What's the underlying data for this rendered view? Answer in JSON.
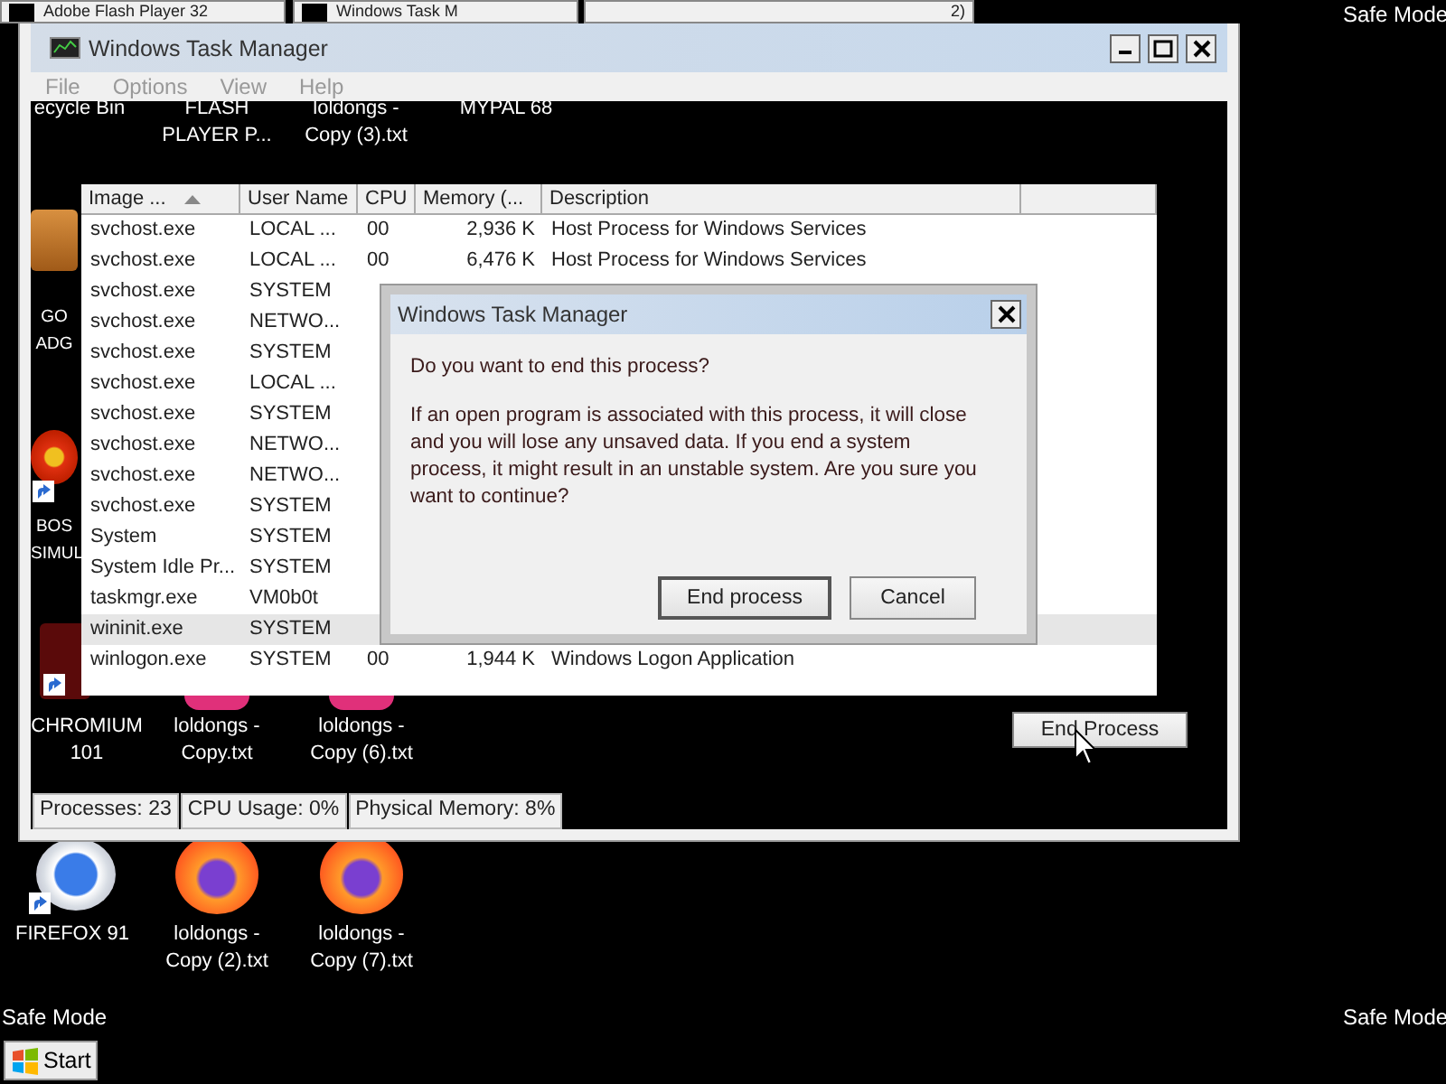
{
  "top_buttons": [
    {
      "label": "Adobe Flash Player 32"
    },
    {
      "label": "Windows Task M"
    },
    {
      "label": "2)"
    }
  ],
  "desktop_icons": [
    {
      "kind": "covered",
      "shortcut": false,
      "lines": [
        "ecycle Bin"
      ]
    },
    {
      "kind": "covered",
      "shortcut": false,
      "lines": [
        "FLASH",
        "PLAYER P..."
      ]
    },
    {
      "kind": "covered",
      "shortcut": false,
      "lines": [
        "loldongs -",
        "Copy (3).txt"
      ]
    },
    {
      "kind": "covered",
      "shortcut": false,
      "lines": [
        "MYPAL 68"
      ]
    },
    {
      "kind": "briefcase",
      "shortcut": false,
      "lines": [
        "GO",
        "ADG"
      ]
    },
    {
      "kind": "flower",
      "shortcut": true,
      "lines": [
        "BOS",
        "SIMUL"
      ]
    },
    {
      "kind": "red-app",
      "shortcut": true,
      "lines": [
        "CHROMIUM",
        "101"
      ]
    },
    {
      "kind": "pink",
      "shortcut": false,
      "lines": [
        "loldongs -",
        "Copy.txt"
      ]
    },
    {
      "kind": "pink",
      "shortcut": false,
      "lines": [
        "loldongs -",
        "Copy (6).txt"
      ]
    },
    {
      "kind": "chrome",
      "shortcut": true,
      "lines": [
        "FIREFOX 91"
      ]
    },
    {
      "kind": "firefox",
      "shortcut": false,
      "lines": [
        "loldongs -",
        "Copy (2).txt"
      ]
    },
    {
      "kind": "firefox",
      "shortcut": false,
      "lines": [
        "loldongs -",
        "Copy (7).txt"
      ]
    }
  ],
  "safe_mode_labels": [
    "Safe Mode",
    "Safe Mode",
    "Safe Mode"
  ],
  "window": {
    "title": "Windows Task Manager",
    "menu": [
      "File",
      "Options",
      "View",
      "Help"
    ],
    "table": {
      "columns": [
        "Image ...",
        "User Name",
        "CPU",
        "Memory (...",
        "Description"
      ],
      "rows": [
        {
          "image": "svchost.exe",
          "user": "LOCAL ...",
          "cpu": "00",
          "memory": "2,936 K",
          "description": "Host Process for Windows Services",
          "selected": false
        },
        {
          "image": "svchost.exe",
          "user": "LOCAL ...",
          "cpu": "00",
          "memory": "6,476 K",
          "description": "Host Process for Windows Services",
          "selected": false
        },
        {
          "image": "svchost.exe",
          "user": "SYSTEM",
          "selected": false
        },
        {
          "image": "svchost.exe",
          "user": "NETWO...",
          "selected": false
        },
        {
          "image": "svchost.exe",
          "user": "SYSTEM",
          "selected": false
        },
        {
          "image": "svchost.exe",
          "user": "LOCAL ...",
          "selected": false
        },
        {
          "image": "svchost.exe",
          "user": "SYSTEM",
          "selected": false
        },
        {
          "image": "svchost.exe",
          "user": "NETWO...",
          "selected": false
        },
        {
          "image": "svchost.exe",
          "user": "NETWO...",
          "selected": false
        },
        {
          "image": "svchost.exe",
          "user": "SYSTEM",
          "selected": false
        },
        {
          "image": "System",
          "user": "SYSTEM",
          "selected": false
        },
        {
          "image": "System Idle Pr...",
          "user": "SYSTEM",
          "selected": false
        },
        {
          "image": "taskmgr.exe",
          "user": "VM0b0t",
          "selected": false
        },
        {
          "image": "wininit.exe",
          "user": "SYSTEM",
          "selected": true
        },
        {
          "image": "winlogon.exe",
          "user": "SYSTEM",
          "cpu": "00",
          "memory": "1,944 K",
          "description": "Windows Logon Application",
          "selected": false
        }
      ]
    },
    "end_button": "End Process",
    "status_bar": [
      "Processes: 23",
      "CPU Usage: 0%",
      "Physical Memory: 8%"
    ]
  },
  "dialog": {
    "title": "Windows Task Manager",
    "question": "Do you want to end this process?",
    "message": "If an open program is associated with this process, it will close and you will lose any unsaved data. If you end a system process, it might result in an unstable system. Are you sure you want to continue?",
    "buttons": [
      {
        "label": "End process",
        "focused": true
      },
      {
        "label": "Cancel",
        "focused": false
      }
    ]
  },
  "start_button": "Start"
}
